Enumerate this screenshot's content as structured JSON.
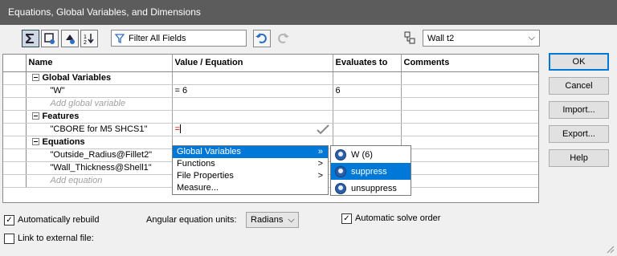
{
  "window": {
    "title": "Equations, Global Variables, and Dimensions"
  },
  "toolbar": {
    "icons": [
      "equation-view-icon",
      "sketch-equation-view-icon",
      "dimension-view-icon",
      "ordered-view-icon"
    ],
    "filter_placeholder": "Filter All Fields",
    "configuration": "Wall t2"
  },
  "table": {
    "headers": [
      "Name",
      "Value / Equation",
      "Evaluates to",
      "Comments"
    ],
    "groups": {
      "global_variables": {
        "label": "Global Variables",
        "rows": [
          {
            "name": "\"W\"",
            "value": "= 6",
            "evaluates": "6",
            "comment": ""
          }
        ],
        "add_placeholder": "Add global variable"
      },
      "features": {
        "label": "Features",
        "rows": [
          {
            "name": "\"CBORE for M5 SHCS1\"",
            "value": "=",
            "evaluates": "",
            "comment": ""
          }
        ]
      },
      "equations": {
        "label": "Equations",
        "rows": [
          {
            "name": "\"Outside_Radius@Fillet2\""
          },
          {
            "name": "\"Wall_Thickness@Shell1\""
          }
        ],
        "add_placeholder": "Add equation"
      }
    }
  },
  "context_menu": {
    "items": [
      {
        "label": "Global Variables",
        "arrow": "»"
      },
      {
        "label": "Functions",
        "arrow": ">"
      },
      {
        "label": "File Properties",
        "arrow": ">"
      },
      {
        "label": "Measure...",
        "arrow": ""
      }
    ],
    "submenu": [
      "W (6)",
      "suppress",
      "unsuppress"
    ]
  },
  "buttons": {
    "ok": "OK",
    "cancel": "Cancel",
    "import": "Import...",
    "export": "Export...",
    "help": "Help"
  },
  "options": {
    "auto_rebuild": "Automatically rebuild",
    "angular_units_label": "Angular equation units:",
    "angular_units_value": "Radians",
    "auto_solve_order": "Automatic solve order",
    "link_external": "Link to external file:"
  },
  "colors": {
    "selection": "#0078d7",
    "title_bar": "#5c5c5c"
  }
}
